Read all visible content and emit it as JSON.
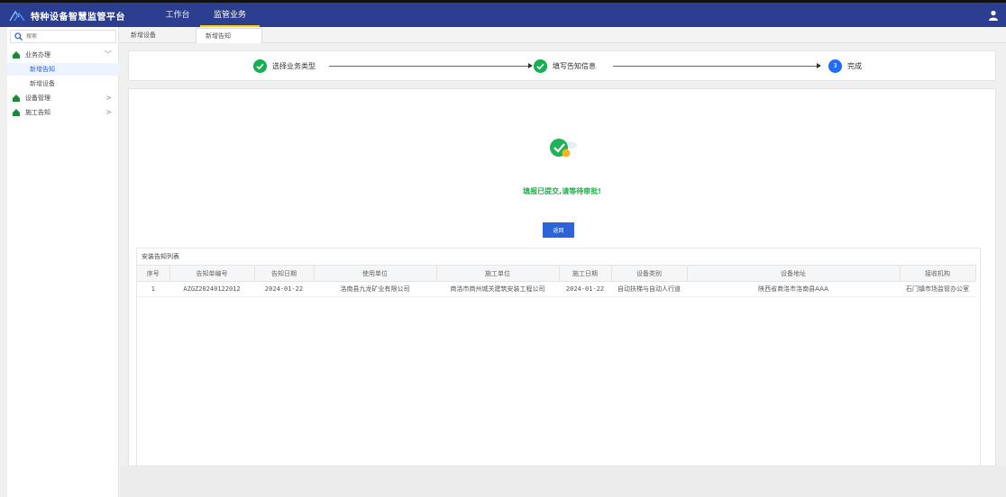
{
  "app": {
    "title": "特种设备智慧监管平台",
    "nav_tabs": [
      {
        "label": "工作台"
      },
      {
        "label": "监管业务"
      }
    ]
  },
  "colors": {
    "topbar": "#2c3e8f",
    "accent": "#2c63d8",
    "success": "#16b054",
    "active_nav_underline": "#ffd000"
  },
  "sidebar": {
    "search_placeholder": "搜索",
    "menu": [
      {
        "label": "业务办理",
        "arrow": "﹀",
        "children": [
          {
            "label": "新增告知"
          },
          {
            "label": "新增设备"
          }
        ]
      },
      {
        "label": "设备管理",
        "arrow": ">"
      },
      {
        "label": "施工告知",
        "arrow": ">"
      }
    ]
  },
  "page_tabs": [
    {
      "label": "新增设备"
    },
    {
      "label": "新增告知"
    }
  ],
  "steps": [
    {
      "label": "选择业务类型",
      "status": "done"
    },
    {
      "label": "填写告知信息",
      "status": "done"
    },
    {
      "number": "3",
      "label": "完成",
      "status": "current"
    }
  ],
  "result": {
    "message": "填报已提交,请等待审批!",
    "return_label": "返回"
  },
  "table": {
    "title": "安装告知列表",
    "headers": [
      "序号",
      "告知单编号",
      "告知日期",
      "使用单位",
      "施工单位",
      "施工日期",
      "设备类别",
      "设备地址",
      "接收机构"
    ],
    "rows": [
      [
        "1",
        "AZGZ20240122012",
        "2024-01-22",
        "洛南县九龙矿业有限公司",
        "商洛市商州城关建筑安装工程公司",
        "2024-01-22",
        "自动扶梯与自动人行道",
        "陕西省商洛市洛南县AAA",
        "石门镇市场监管办公室"
      ]
    ]
  }
}
